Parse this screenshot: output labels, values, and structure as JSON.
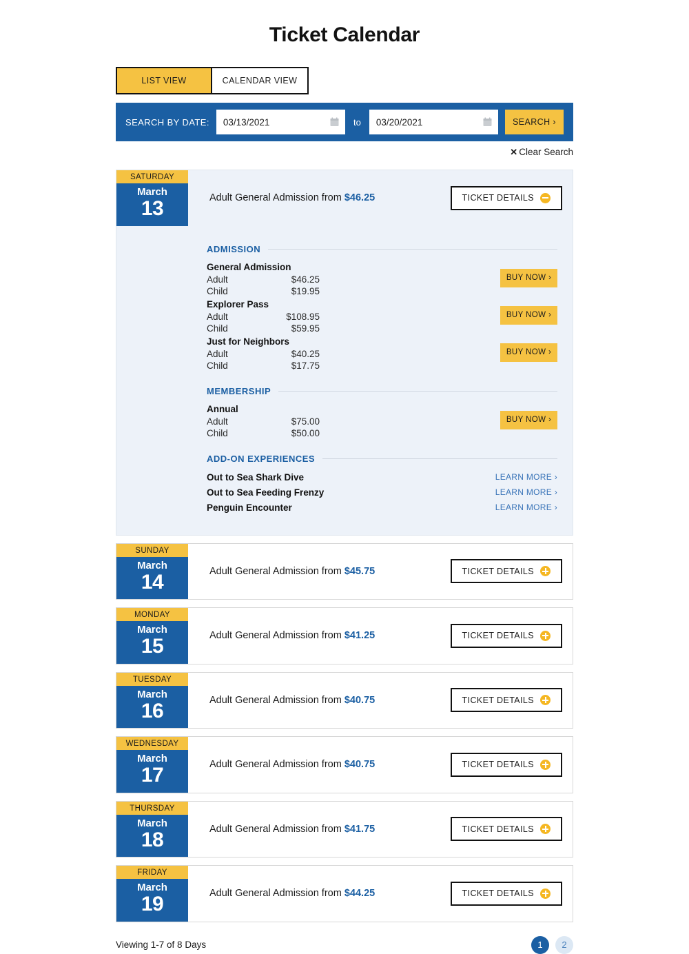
{
  "page_title": "Ticket Calendar",
  "view_toggle": {
    "options": [
      {
        "label": "LIST VIEW",
        "active": true
      },
      {
        "label": "CALENDAR VIEW",
        "active": false
      }
    ]
  },
  "search": {
    "label": "SEARCH BY DATE:",
    "from_value": "03/13/2021",
    "from_placeholder": "MM/DD/YYYY",
    "to_word": "to",
    "to_value": "03/20/2021",
    "to_placeholder": "MM/DD/YYYY",
    "button_label": "SEARCH ›",
    "calendar_icon": "calendar-icon"
  },
  "clear_search": {
    "icon": "close-x-icon",
    "x": "✕",
    "label": "Clear Search"
  },
  "summary_prefix": "Adult General Admission from ",
  "details_button_label": "TICKET DETAILS",
  "days": [
    {
      "dow": "SATURDAY",
      "month": "March",
      "day": "13",
      "price": "$46.25",
      "expanded": true,
      "sections": [
        {
          "title": "ADMISSION",
          "type": "tickets",
          "items": [
            {
              "name": "General Admission",
              "prices": [
                {
                  "who": "Adult",
                  "amount": "$46.25"
                },
                {
                  "who": "Child",
                  "amount": "$19.95"
                }
              ],
              "buy_label": "BUY NOW ›"
            },
            {
              "name": "Explorer Pass",
              "prices": [
                {
                  "who": "Adult",
                  "amount": "$108.95"
                },
                {
                  "who": "Child",
                  "amount": "$59.95"
                }
              ],
              "buy_label": "BUY NOW ›"
            },
            {
              "name": "Just for Neighbors",
              "prices": [
                {
                  "who": "Adult",
                  "amount": "$40.25"
                },
                {
                  "who": "Child",
                  "amount": "$17.75"
                }
              ],
              "buy_label": "BUY NOW ›"
            }
          ]
        },
        {
          "title": "MEMBERSHIP",
          "type": "tickets",
          "items": [
            {
              "name": "Annual",
              "prices": [
                {
                  "who": "Adult",
                  "amount": "$75.00"
                },
                {
                  "who": "Child",
                  "amount": "$50.00"
                }
              ],
              "buy_label": "BUY NOW ›"
            }
          ]
        },
        {
          "title": "ADD-ON EXPERIENCES",
          "type": "addons",
          "items": [
            {
              "name": "Out to Sea Shark Dive",
              "link_label": "LEARN MORE ›"
            },
            {
              "name": "Out to Sea Feeding Frenzy",
              "link_label": "LEARN MORE ›"
            },
            {
              "name": "Penguin Encounter",
              "link_label": "LEARN MORE ›"
            }
          ]
        }
      ]
    },
    {
      "dow": "SUNDAY",
      "month": "March",
      "day": "14",
      "price": "$45.75",
      "expanded": false
    },
    {
      "dow": "MONDAY",
      "month": "March",
      "day": "15",
      "price": "$41.25",
      "expanded": false
    },
    {
      "dow": "TUESDAY",
      "month": "March",
      "day": "16",
      "price": "$40.75",
      "expanded": false
    },
    {
      "dow": "WEDNESDAY",
      "month": "March",
      "day": "17",
      "price": "$40.75",
      "expanded": false
    },
    {
      "dow": "THURSDAY",
      "month": "March",
      "day": "18",
      "price": "$41.75",
      "expanded": false
    },
    {
      "dow": "FRIDAY",
      "month": "March",
      "day": "19",
      "price": "$44.25",
      "expanded": false
    }
  ],
  "footer": {
    "viewing": "Viewing 1-7 of 8 Days",
    "pages": [
      {
        "label": "1",
        "active": true
      },
      {
        "label": "2",
        "active": false
      }
    ]
  },
  "colors": {
    "brand_blue": "#1B5FA3",
    "brand_yellow": "#F5C242",
    "link_blue": "#3A74B8",
    "panel_tint": "#EDF2F9"
  }
}
